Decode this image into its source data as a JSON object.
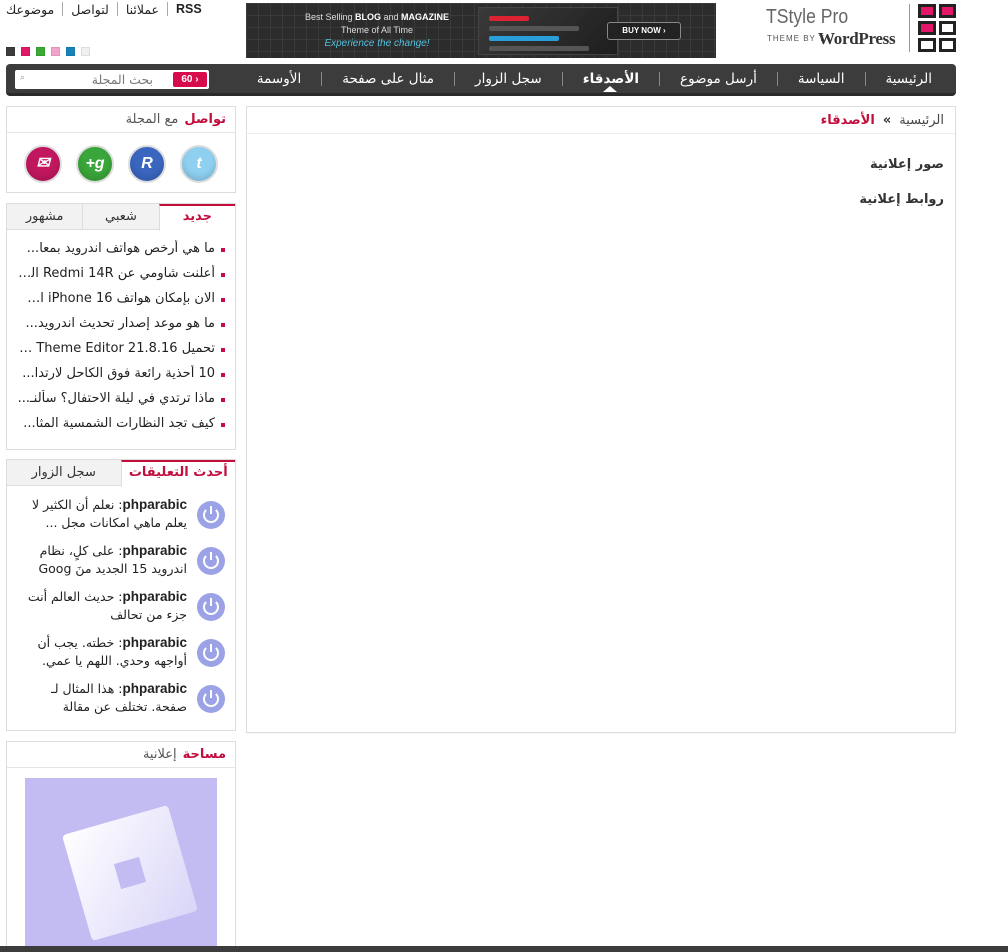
{
  "toplinks": {
    "rss": "RSS",
    "items": [
      "عملائنا",
      "لتواصل",
      "موضوعك"
    ]
  },
  "theme_swatches": [
    "#3c3c3c",
    "#e2176a",
    "#3aaa35",
    "#f1a3c9",
    "#1783b8",
    "#dddddd"
  ],
  "banner": {
    "line1_prefix": "Best Selling ",
    "line1_bold1": "BLOG",
    "line1_and": " and ",
    "line1_bold2": "MAGAZINE",
    "line2": "Theme of All Time",
    "line3": "Experience the change!",
    "button": "BUY NOW ›"
  },
  "logo": {
    "name": "TStyle Pro",
    "by": "THEME BY T",
    "wp": "WordPress"
  },
  "nav": {
    "items": [
      {
        "label": "الرئيسية"
      },
      {
        "label": "السياسة"
      },
      {
        "label": "أرسل موضوع"
      },
      {
        "label": "الأصدقاء"
      },
      {
        "label": "سجل الزوار"
      },
      {
        "label": "مثال على صفحة"
      },
      {
        "label": "الأوسمة"
      }
    ],
    "active_label": "الأصدقاء",
    "search_placeholder": "بحث المجلة",
    "search_count": "60 ›"
  },
  "breadcrumb": {
    "home": "الرئيسية",
    "sep": "»",
    "current": "الأصدقاء"
  },
  "main": {
    "section1": "صور إعلانية",
    "section2": "روابط إعلانية"
  },
  "social_box": {
    "title_strong": "تواصل",
    "title_rest": "مع المجلة",
    "icons": [
      {
        "name": "twitter-icon",
        "color": "#8fd0f0",
        "glyph": "t"
      },
      {
        "name": "renren-icon",
        "color": "#3a66c0",
        "glyph": "R"
      },
      {
        "name": "google-plus-icon",
        "color": "#3aa53a",
        "glyph": "g+"
      },
      {
        "name": "mail-icon",
        "color": "#c0175f",
        "glyph": "✉"
      }
    ]
  },
  "posts_box": {
    "tabs": [
      "جديد",
      "شعبي",
      "مشهور"
    ],
    "active_tab": "جديد",
    "items": [
      "ما هي أرخص هواتف اندرويد بمعا...",
      "أعلنت شاومي عن Redmi 14R الج...",
      "الان بإمكان هواتف iPhone 16 اس...",
      "ما هو موعد إصدار تحديث اندرويد...",
      "تحميل UI Theme Editor 21.8.16...",
      "10 أحذية رائعة فوق الكاحل لارتدا...",
      "ماذا ترتدي في ليلة الاحتفال؟ سألنـ...",
      "كيف تجد النظارات الشمسية المثا..."
    ]
  },
  "comments_box": {
    "tabs": [
      "أحدث التعليقات",
      "سجل الزوار"
    ],
    "active_tab": "أحدث التعليقات",
    "items": [
      {
        "author": "phparabic",
        "text": "نعلم أن الكثير لا يعلم ماهي امكانات مجل ..."
      },
      {
        "author": "phparabic",
        "text": "على كلٍ، نظام اندرويد 15 الجديد منَ Goog"
      },
      {
        "author": "phparabic",
        "text": "حديث العالم أنت جزء من تحالف"
      },
      {
        "author": "phparabic",
        "text": "خطته. يجب أن أواجهه وحدي. اللهم يا عمي."
      },
      {
        "author": "phparabic",
        "text": "هذا المثال لـ صفحة. تختلف عن مقالة"
      }
    ]
  },
  "ad_box": {
    "title_strong": "مساحة",
    "title_rest": "إعلانية"
  },
  "colors": {
    "accent": "#c20d3d",
    "nav_bg": "#3c3c3c",
    "badge": "#d70a4b"
  }
}
